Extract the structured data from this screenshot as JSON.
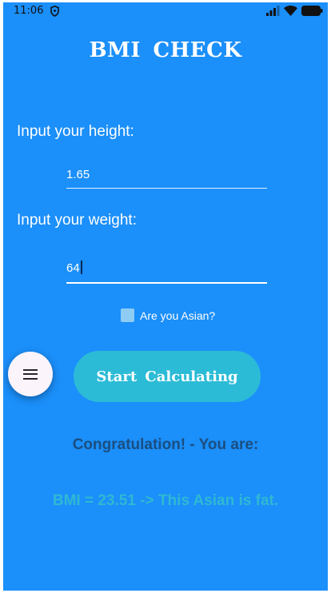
{
  "status_bar": {
    "time": "11:06"
  },
  "app": {
    "title": "BMI CHECK"
  },
  "height_field": {
    "label": "Input your height:",
    "value": "1.65"
  },
  "weight_field": {
    "label": "Input your weight:",
    "value": "64"
  },
  "asian_checkbox": {
    "label": "Are you Asian?"
  },
  "start_button": {
    "label": "Start Calculating"
  },
  "result": {
    "congrats_text": "Congratulation! - You are:",
    "bmi_text": "BMI = 23.51 -> This Asian is fat."
  },
  "icons": {
    "status": [
      "shield-icon",
      "signal-icon",
      "wifi-icon",
      "battery-icon"
    ],
    "fab": "menu-icon"
  },
  "colors": {
    "background": "#1b8ffa",
    "button": "#2cbbd6",
    "congrats_text": "#1b4e80",
    "result_text": "#2fb9d2",
    "checkbox": "#8fccf3"
  }
}
